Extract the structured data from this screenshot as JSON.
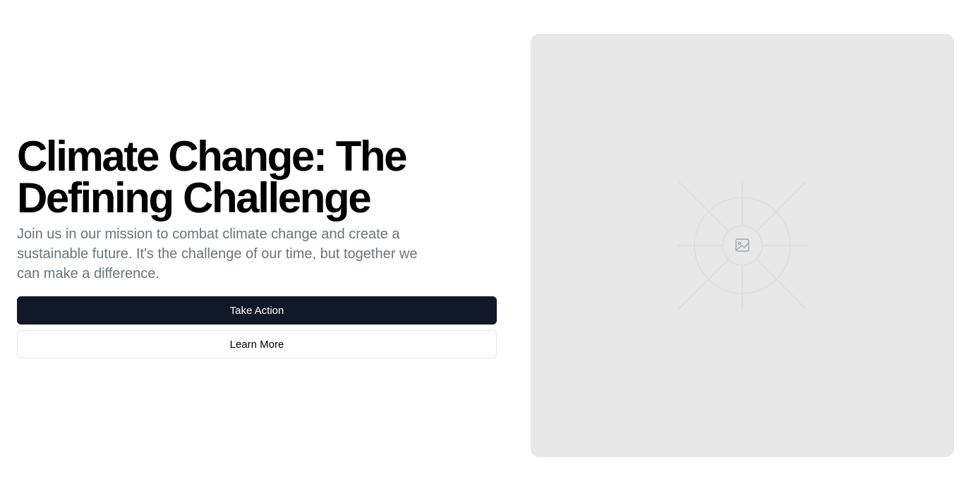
{
  "hero": {
    "title": "Climate Change: The Defining Challenge",
    "subtitle": "Join us in our mission to combat climate change and create a sustainable future. It's the challenge of our time, but together we can make a difference.",
    "primary_button_label": "Take Action",
    "secondary_button_label": "Learn More"
  },
  "image_placeholder": {
    "icon": "image-icon",
    "background_color": "#e8e8e8"
  },
  "colors": {
    "primary_button_bg": "#111827",
    "subtitle_text": "#6b7280"
  }
}
